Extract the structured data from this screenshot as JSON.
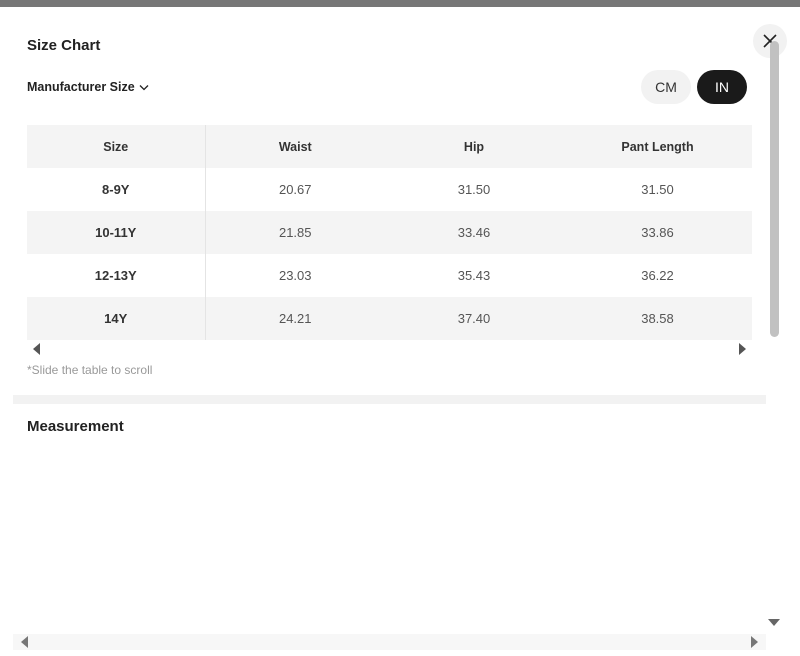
{
  "modal": {
    "title": "Size Chart",
    "size_selector_label": "Manufacturer Size",
    "units": {
      "cm_label": "CM",
      "in_label": "IN",
      "selected": "IN"
    },
    "table": {
      "headers": [
        "Size",
        "Waist",
        "Hip",
        "Pant Length"
      ],
      "rows": [
        [
          "8-9Y",
          "20.67",
          "31.50",
          "31.50"
        ],
        [
          "10-11Y",
          "21.85",
          "33.46",
          "33.86"
        ],
        [
          "12-13Y",
          "23.03",
          "35.43",
          "36.22"
        ],
        [
          "14Y",
          "24.21",
          "37.40",
          "38.58"
        ]
      ]
    },
    "scroll_hint": "*Slide the table to scroll",
    "measurement_title": "Measurement"
  },
  "icons": {
    "close": "close-icon",
    "dropdown": "chevron-down-icon",
    "scroll_left": "arrow-left-icon",
    "scroll_right": "arrow-right-icon",
    "scroll_down": "arrow-down-icon"
  },
  "colors": {
    "accent": "#1a1a1a",
    "header_bg": "#f4f4f4",
    "hint_text": "#999999"
  }
}
